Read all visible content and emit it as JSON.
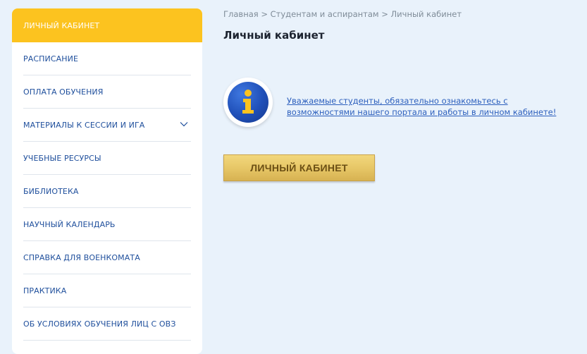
{
  "sidebar": {
    "items": [
      {
        "label": "ЛИЧНЫЙ КАБИНЕТ",
        "active": true
      },
      {
        "label": "РАСПИСАНИЕ"
      },
      {
        "label": "ОПЛАТА ОБУЧЕНИЯ"
      },
      {
        "label": "МАТЕРИАЛЫ К СЕССИИ И ИГА",
        "has_submenu": true
      },
      {
        "label": "УЧЕБНЫЕ РЕСУРСЫ"
      },
      {
        "label": "БИБЛИОТЕКА"
      },
      {
        "label": "НАУЧНЫЙ КАЛЕНДАРЬ"
      },
      {
        "label": "СПРАВКА ДЛЯ ВОЕНКОМАТА"
      },
      {
        "label": "ПРАКТИКА"
      },
      {
        "label": "ОБ УСЛОВИЯХ ОБУЧЕНИЯ ЛИЦ С ОВЗ"
      }
    ]
  },
  "breadcrumb": {
    "items": [
      "Главная",
      "Студентам и аспирантам",
      "Личный кабинет"
    ],
    "separator": ">"
  },
  "page": {
    "title": "Личный кабинет"
  },
  "notice": {
    "icon": "info-icon",
    "text": "Уважаемые студенты, обязательно ознакомьтесь с возможностями нашего портала и работы в личном кабинете!"
  },
  "cabinet_button": {
    "label": "ЛИЧНЫЙ КАБИНЕТ"
  },
  "colors": {
    "background": "#e9f2fb",
    "active_item": "#fcc31f",
    "menu_text": "#1f4f9c",
    "link": "#2c5fbd",
    "button_gold": "#e7c767"
  }
}
